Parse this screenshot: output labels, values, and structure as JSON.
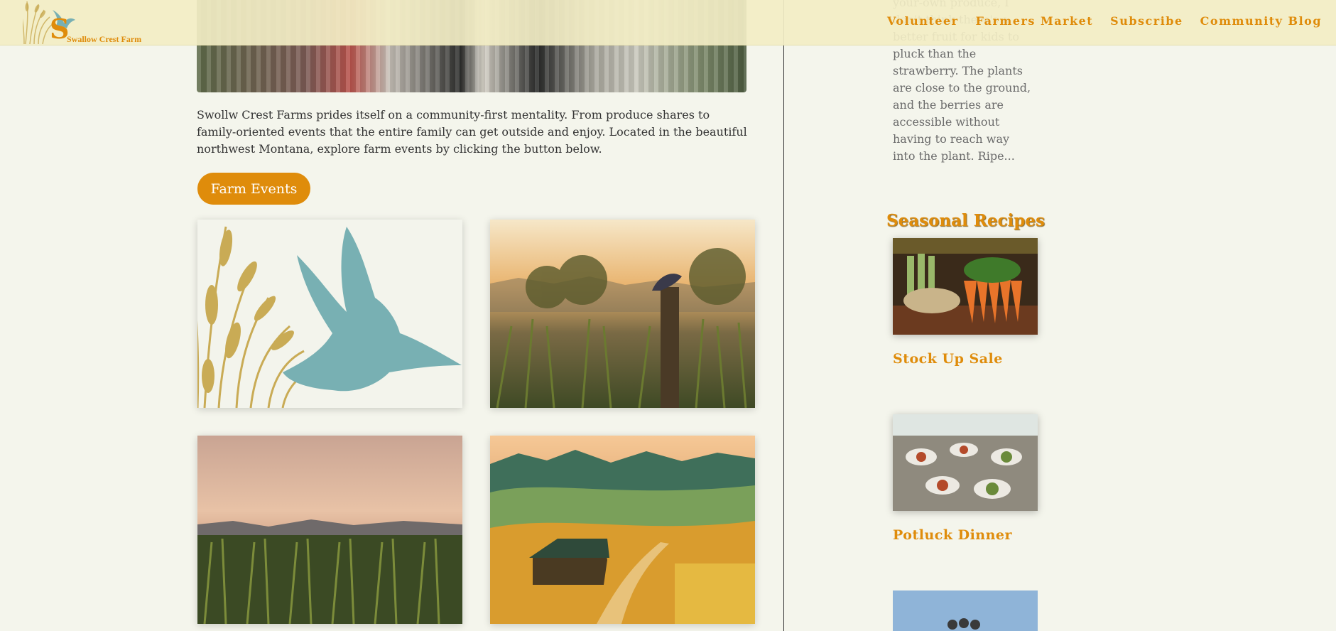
{
  "header": {
    "logo_text": "Swallow Crest Farm",
    "logo_letter": "S",
    "nav": [
      {
        "label": "Volunteer"
      },
      {
        "label": "Farmers Market"
      },
      {
        "label": "Subscribe"
      },
      {
        "label": "Community Blog"
      }
    ]
  },
  "main": {
    "intro": "Swollw Crest Farms prides itself on a community-first mentality. From produce shares to family-oriented events that the entire family can get outside and enjoy. Located in the beautiful northwest Montana, explore farm events by clicking the button below.",
    "button_label": "Farm Events"
  },
  "sidebar": {
    "excerpt": "your-own produce, I don't think there's a better fruit for kids to pluck than the strawberry. The plants are close to the ground, and the berries are accessible without having to reach way into the plant. Ripe...",
    "heading": "Seasonal Recipes",
    "recipes": [
      {
        "title": "Stock Up Sale"
      },
      {
        "title": "Potluck Dinner"
      }
    ]
  },
  "colors": {
    "accent": "#df8c0b",
    "header_bg": "#f2edc4",
    "page_bg": "#f4f5ec",
    "bird": "#78b0b3",
    "wheat": "#c9ab55"
  },
  "icons": [
    "swallow-logo-icon"
  ]
}
